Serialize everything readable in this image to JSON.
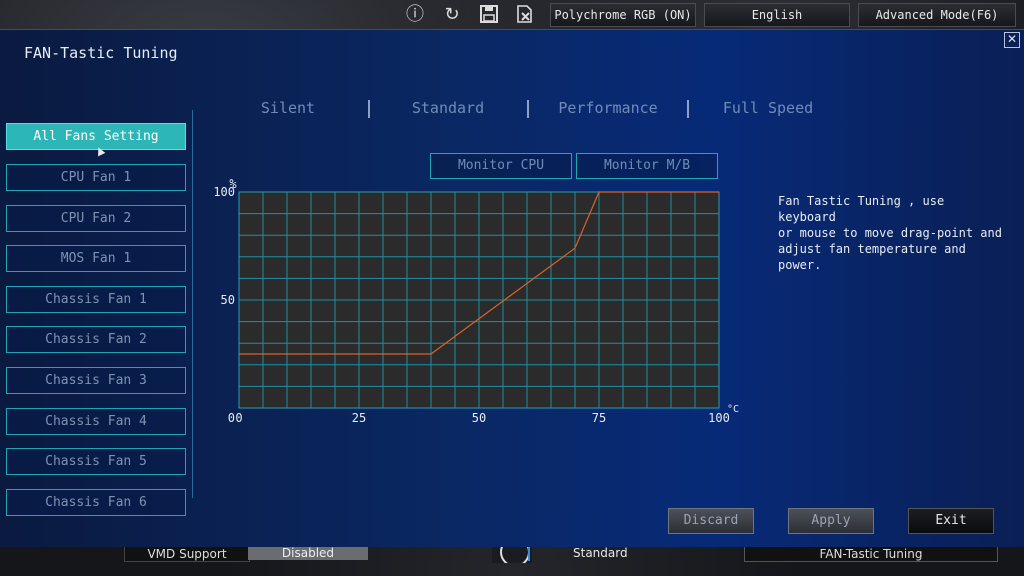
{
  "topbar": {
    "icons": [
      "info-icon",
      "refresh-icon",
      "save-icon",
      "discard-file-icon"
    ],
    "polychrome_label": "Polychrome RGB (ON)",
    "language_label": "English",
    "advanced_mode_label": "Advanced Mode(F6)"
  },
  "dialog": {
    "title": "FAN-Tastic Tuning",
    "close_glyph": "✕"
  },
  "fans": [
    {
      "label": "All Fans Setting",
      "active": true
    },
    {
      "label": "CPU Fan 1"
    },
    {
      "label": "CPU Fan 2"
    },
    {
      "label": "MOS Fan 1"
    },
    {
      "label": "Chassis Fan 1"
    },
    {
      "label": "Chassis Fan 2"
    },
    {
      "label": "Chassis Fan 3"
    },
    {
      "label": "Chassis Fan 4"
    },
    {
      "label": "Chassis Fan 5"
    },
    {
      "label": "Chassis Fan 6"
    }
  ],
  "modes": [
    "Silent",
    "Standard",
    "Performance",
    "Full Speed"
  ],
  "monitor": {
    "cpu_label": "Monitor CPU",
    "mb_label": "Monitor M/B"
  },
  "help_text": "Fan Tastic Tuning , use keyboard\nor mouse to move drag-point and\nadjust fan temperature and power.",
  "chart_data": {
    "type": "line",
    "title": "",
    "xlabel": "",
    "ylabel": "",
    "x_unit": "°C",
    "y_unit": "%",
    "xlim": [
      0,
      100
    ],
    "ylim": [
      0,
      100
    ],
    "x_ticks": [
      "0",
      "25",
      "50",
      "75",
      "100"
    ],
    "y_ticks": [
      "0",
      "50",
      "100"
    ],
    "grid": true,
    "series": [
      {
        "color": "#d9622b",
        "points": [
          [
            0,
            25
          ],
          [
            40,
            25
          ],
          [
            70,
            74
          ],
          [
            75,
            100
          ],
          [
            100,
            100
          ]
        ]
      }
    ]
  },
  "buttons": {
    "discard_label": "Discard",
    "apply_label": "Apply",
    "exit_label": "Exit"
  },
  "background": {
    "vmd_label": "VMD Support",
    "vmd_value": "Disabled",
    "profile_label": "Standard",
    "fan_tuning_label": "FAN-Tastic Tuning"
  }
}
